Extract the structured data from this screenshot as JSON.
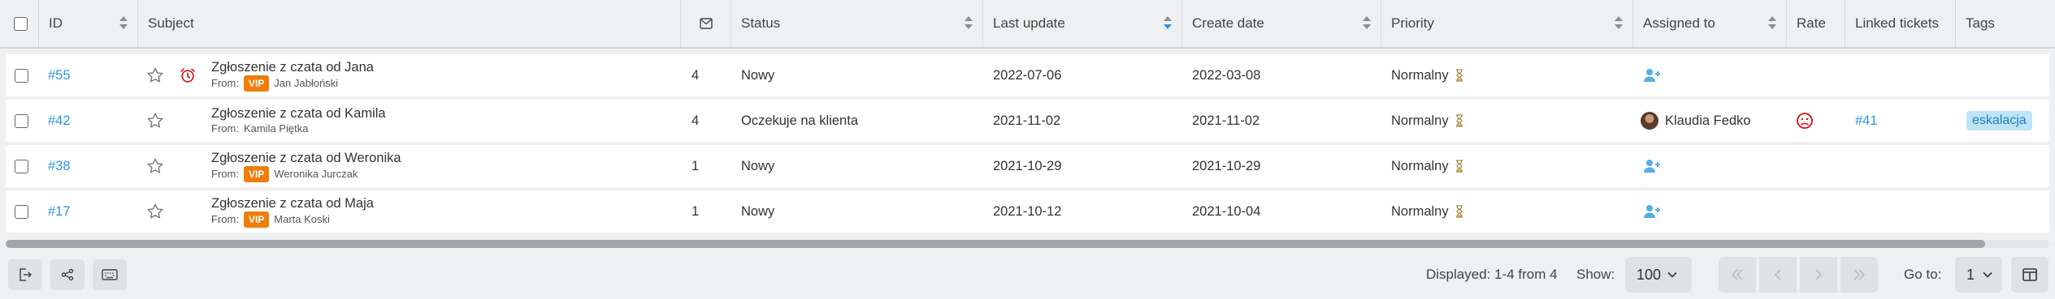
{
  "header": {
    "id": "ID",
    "subject": "Subject",
    "status": "Status",
    "last_update": "Last update",
    "create_date": "Create date",
    "priority": "Priority",
    "assigned_to": "Assigned to",
    "rate": "Rate",
    "linked_tickets": "Linked tickets",
    "tags": "Tags"
  },
  "rows": [
    {
      "id": "#55",
      "title": "Zgłoszenie z czata od Jana",
      "from_label": "From:",
      "vip": "VIP",
      "from_name": "Jan Jabłoński",
      "count": "4",
      "status": "Nowy",
      "last_update": "2022-07-06",
      "create_date": "2022-03-08",
      "priority": "Normalny"
    },
    {
      "id": "#42",
      "title": "Zgłoszenie z czata od Kamila",
      "from_label": "From:",
      "from_name": "Kamila Piętka",
      "count": "4",
      "status": "Oczekuje na klienta",
      "last_update": "2021-11-02",
      "create_date": "2021-11-02",
      "priority": "Normalny",
      "assignee": "Klaudia Fedko",
      "linked": "#41",
      "tag": "eskalacja"
    },
    {
      "id": "#38",
      "title": "Zgłoszenie z czata od Weronika",
      "from_label": "From:",
      "vip": "VIP",
      "from_name": "Weronika Jurczak",
      "count": "1",
      "status": "Nowy",
      "last_update": "2021-10-29",
      "create_date": "2021-10-29",
      "priority": "Normalny"
    },
    {
      "id": "#17",
      "title": "Zgłoszenie z czata od Maja",
      "from_label": "From:",
      "vip": "VIP",
      "from_name": "Marta Koski",
      "count": "1",
      "status": "Nowy",
      "last_update": "2021-10-12",
      "create_date": "2021-10-04",
      "priority": "Normalny"
    }
  ],
  "footer": {
    "displayed": "Displayed: 1-4 from 4",
    "show_label": "Show:",
    "show_value": "100",
    "goto_label": "Go to:",
    "goto_value": "1"
  },
  "icons": {
    "export": "export-icon",
    "share": "share-icon",
    "keyboard": "keyboard-icon",
    "envelope": "envelope-icon",
    "star": "star-icon",
    "alarm": "alarm-clock-icon",
    "hourglass": "hourglass-icon",
    "assign": "assign-user-icon",
    "sad": "sad-face-icon",
    "columns": "columns-icon"
  },
  "colors": {
    "link": "#2b97e0",
    "vip": "#f07d0a",
    "tag_bg": "#bfe3f7",
    "alarm": "#d0121a"
  }
}
